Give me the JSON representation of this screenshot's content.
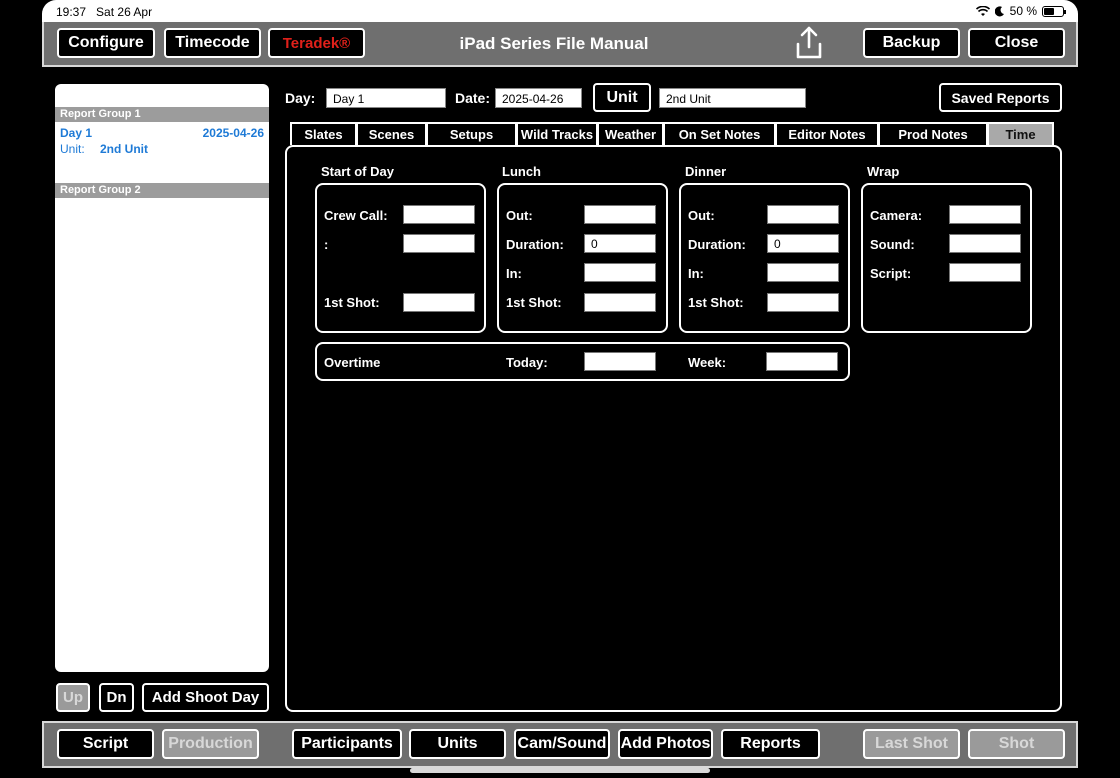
{
  "status": {
    "time": "19:37",
    "date": "Sat 26 Apr",
    "battery": "50 %"
  },
  "toolbar": {
    "configure": "Configure",
    "timecode": "Timecode",
    "teradek": "Teradek®",
    "title": "iPad Series File Manual",
    "backup": "Backup",
    "close": "Close"
  },
  "sidebar": {
    "group1": "Report Group 1",
    "day": {
      "name": "Day 1",
      "date": "2025-04-26",
      "unit_label": "Unit:",
      "unit_value": "2nd Unit"
    },
    "group2": "Report Group 2",
    "up": "Up",
    "dn": "Dn",
    "add_shoot_day": "Add Shoot Day"
  },
  "header": {
    "day_label": "Day:",
    "day_value": "Day 1",
    "date_label": "Date:",
    "date_value": "2025-04-26",
    "unit_button": "Unit",
    "unit_value": "2nd Unit",
    "saved_reports": "Saved Reports"
  },
  "tabs": [
    "Slates",
    "Scenes",
    "Setups",
    "Wild Tracks",
    "Weather",
    "On Set Notes",
    "Editor Notes",
    "Prod Notes",
    "Time"
  ],
  "time": {
    "start_of_day": {
      "title": "Start of Day",
      "crew_call": "Crew Call:",
      "colon": ":",
      "first_shot": "1st Shot:"
    },
    "lunch": {
      "title": "Lunch",
      "out": "Out:",
      "duration": "Duration:",
      "duration_value": "0",
      "in": "In:",
      "first_shot": "1st Shot:"
    },
    "dinner": {
      "title": "Dinner",
      "out": "Out:",
      "duration": "Duration:",
      "duration_value": "0",
      "in": "In:",
      "first_shot": "1st Shot:"
    },
    "wrap": {
      "title": "Wrap",
      "camera": "Camera:",
      "sound": "Sound:",
      "script": "Script:"
    },
    "overtime": {
      "title": "Overtime",
      "today": "Today:",
      "week": "Week:"
    }
  },
  "bottom": {
    "script": "Script",
    "production": "Production",
    "participants": "Participants",
    "units": "Units",
    "cam_sound": "Cam/Sound",
    "add_photos": "Add Photos",
    "reports": "Reports",
    "last_shot": "Last Shot",
    "shot": "Shot"
  }
}
